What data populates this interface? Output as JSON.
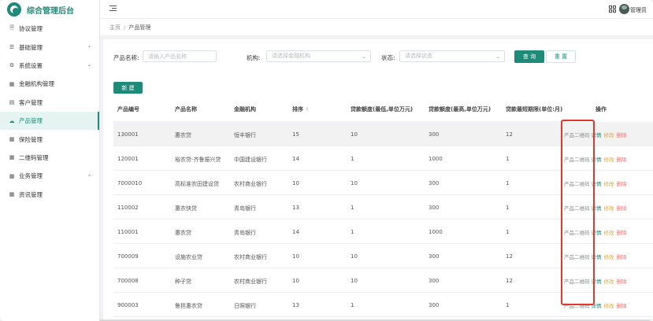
{
  "app": {
    "title": "综合管理后台"
  },
  "header": {
    "user_name": "管理员"
  },
  "sidebar": {
    "items": [
      {
        "label": "协议管理",
        "icon": "document-icon",
        "has_children": false,
        "active": false
      },
      {
        "label": "基础管理",
        "icon": "sliders-icon",
        "has_children": true,
        "active": false
      },
      {
        "label": "系统设置",
        "icon": "gear-icon",
        "has_children": true,
        "active": false
      },
      {
        "label": "金融机构管理",
        "icon": "bank-icon",
        "has_children": false,
        "active": false
      },
      {
        "label": "客户管理",
        "icon": "user-icon",
        "has_children": false,
        "active": false
      },
      {
        "label": "产品管理",
        "icon": "product-icon",
        "has_children": false,
        "active": true
      },
      {
        "label": "保险管理",
        "icon": "shield-icon",
        "has_children": false,
        "active": false
      },
      {
        "label": "二维码管理",
        "icon": "qrcode-icon",
        "has_children": false,
        "active": false
      },
      {
        "label": "业务管理",
        "icon": "briefcase-icon",
        "has_children": true,
        "active": false
      },
      {
        "label": "资讯管理",
        "icon": "news-icon",
        "has_children": false,
        "active": false
      }
    ]
  },
  "breadcrumb": {
    "home": "主页",
    "separator": "/",
    "current": "产品管理"
  },
  "filters": {
    "product_name_label": "产品名称:",
    "product_name_placeholder": "请输入产品名称",
    "institution_label": "机构:",
    "institution_placeholder": "请选择金融机构",
    "status_label": "状态:",
    "status_placeholder": "请选择状态",
    "search_button": "查 询",
    "reset_button": "重 置"
  },
  "toolbar": {
    "new_button": "新 建"
  },
  "table": {
    "columns": [
      "产品编号",
      "产品名称",
      "金融机构",
      "排序",
      "贷款额度(最低,单位万元)",
      "贷款额度(最高,单位万元)",
      "贷款最短期限(单位:月)",
      "操作"
    ],
    "actions": {
      "qr": "产品二维码",
      "detail": "详情",
      "edit": "修改",
      "delete": "删除"
    },
    "rows": [
      {
        "id": "130001",
        "name": "惠农贷",
        "institution": "恒丰银行",
        "sort": "15",
        "min": "10",
        "max": "300",
        "term": "12"
      },
      {
        "id": "120001",
        "name": "裕农贷-齐鲁振兴贷",
        "institution": "中国建设银行",
        "sort": "14",
        "min": "1",
        "max": "1000",
        "term": "1"
      },
      {
        "id": "7000010",
        "name": "高标准农田建设贷",
        "institution": "农村商业银行",
        "sort": "10",
        "min": "10",
        "max": "300",
        "term": "1"
      },
      {
        "id": "110002",
        "name": "惠农快贷",
        "institution": "青岛银行",
        "sort": "13",
        "min": "1",
        "max": "300",
        "term": "1"
      },
      {
        "id": "110001",
        "name": "惠农贷",
        "institution": "青岛银行",
        "sort": "14",
        "min": "1",
        "max": "1000",
        "term": "1"
      },
      {
        "id": "700009",
        "name": "设施农业贷",
        "institution": "农村商业银行",
        "sort": "10",
        "min": "10",
        "max": "300",
        "term": "12"
      },
      {
        "id": "700008",
        "name": "种子贷",
        "institution": "农村商业银行",
        "sort": "10",
        "min": "10",
        "max": "300",
        "term": "12"
      },
      {
        "id": "900003",
        "name": "鲁担惠农贷",
        "institution": "日照银行",
        "sort": "13",
        "min": "1",
        "max": "300",
        "term": "1"
      }
    ]
  },
  "colors": {
    "accent": "#1d8a7a",
    "edit": "#e6a23c",
    "delete": "#f56c6c",
    "highlight": "#e0392b"
  }
}
